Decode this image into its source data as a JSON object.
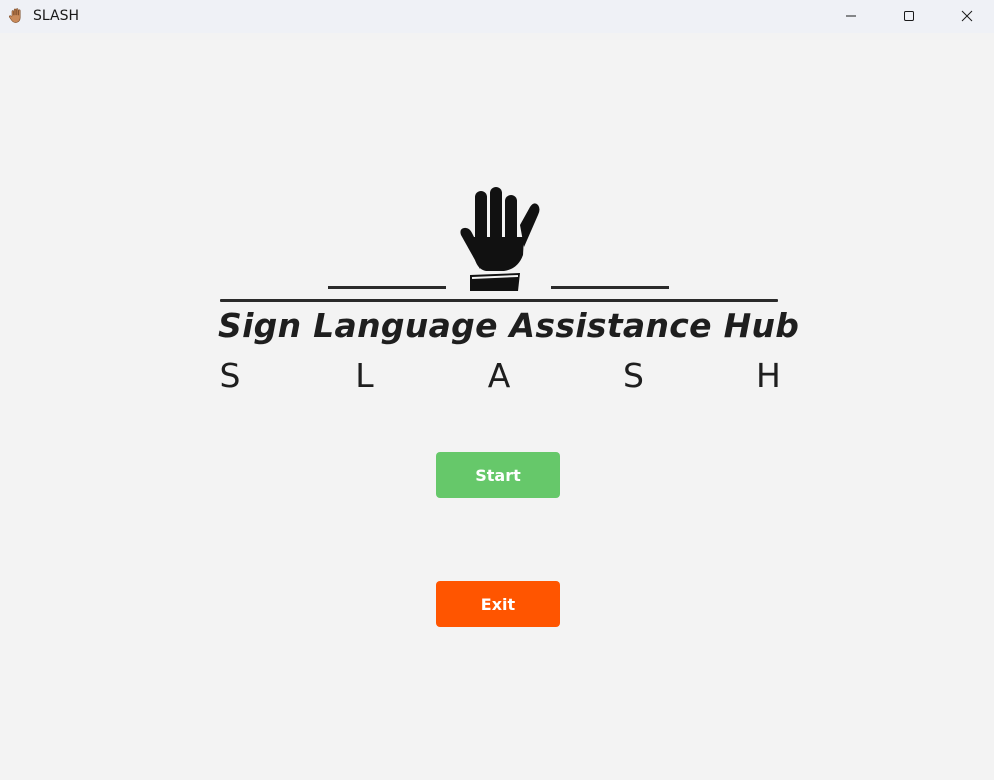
{
  "window": {
    "title": "SLASH",
    "icon": "hand-icon"
  },
  "caption": {
    "minimize_icon": "minimize-icon",
    "maximize_icon": "maximize-icon",
    "close_icon": "close-icon"
  },
  "logo": {
    "icon": "raised-hand-icon",
    "title": "Sign Language Assistance Hub",
    "acronym_letters": [
      "S",
      "L",
      "A",
      "S",
      "H"
    ]
  },
  "buttons": {
    "start_label": "Start",
    "exit_label": "Exit"
  },
  "colors": {
    "start": "#66c86a",
    "exit": "#ff5500",
    "background": "#f3f3f3",
    "text": "#1e1e1e"
  }
}
